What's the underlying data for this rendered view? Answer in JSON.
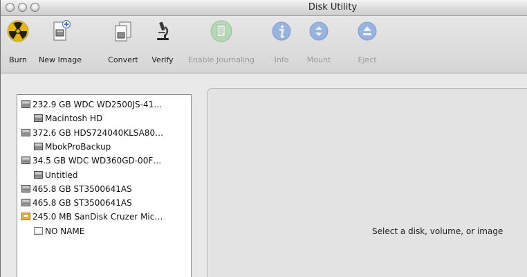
{
  "window": {
    "title": "Disk Utility"
  },
  "toolbar": [
    {
      "label": "Burn",
      "icon": "burn-icon",
      "enabled": true
    },
    {
      "label": "New Image",
      "icon": "new-image-icon",
      "enabled": true
    },
    {
      "label": "Convert",
      "icon": "convert-icon",
      "enabled": true
    },
    {
      "label": "Verify",
      "icon": "microscope-icon",
      "enabled": true
    },
    {
      "label": "Enable Journaling",
      "icon": "journaling-icon",
      "enabled": false
    },
    {
      "label": "Info",
      "icon": "info-icon",
      "enabled": false
    },
    {
      "label": "Mount",
      "icon": "mount-icon",
      "enabled": false
    },
    {
      "label": "Eject",
      "icon": "eject-icon",
      "enabled": false
    }
  ],
  "sidebar": {
    "items": [
      {
        "label": "232.9 GB WDC WD2500JS-41…",
        "kind": "disk"
      },
      {
        "label": "Macintosh HD",
        "kind": "volume"
      },
      {
        "label": "372.6 GB HDS724040KLSA80…",
        "kind": "disk"
      },
      {
        "label": "MbokProBackup",
        "kind": "volume"
      },
      {
        "label": "34.5 GB WDC WD360GD-00F…",
        "kind": "disk"
      },
      {
        "label": "Untitled",
        "kind": "volume"
      },
      {
        "label": "465.8 GB ST3500641AS",
        "kind": "disk"
      },
      {
        "label": "465.8 GB ST3500641AS",
        "kind": "disk"
      },
      {
        "label": "245.0 MB SanDisk Cruzer Mic…",
        "kind": "usb-disk"
      },
      {
        "label": "NO NAME",
        "kind": "usb-volume"
      }
    ]
  },
  "detail": {
    "placeholder": "Select a disk, volume, or image"
  }
}
